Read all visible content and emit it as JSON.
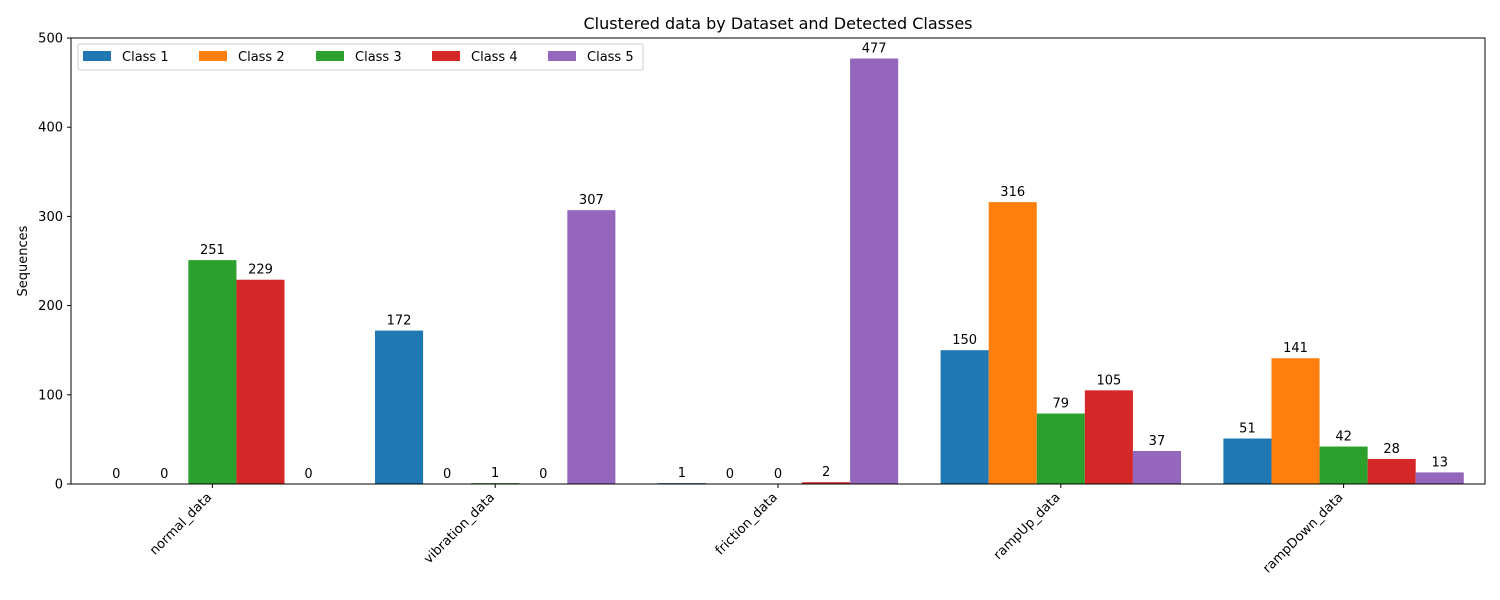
{
  "chart_data": {
    "type": "bar",
    "title": "Clustered data by Dataset and Detected Classes",
    "xlabel": "",
    "ylabel": "Sequences",
    "categories": [
      "normal_data",
      "vibration_data",
      "friction_data",
      "rampUp_data",
      "rampDown_data"
    ],
    "series": [
      {
        "name": "Class 1",
        "color": "#1f77b4",
        "values": [
          0,
          172,
          1,
          150,
          51
        ]
      },
      {
        "name": "Class 2",
        "color": "#ff7f0e",
        "values": [
          0,
          0,
          0,
          316,
          141
        ]
      },
      {
        "name": "Class 3",
        "color": "#2ca02c",
        "values": [
          251,
          1,
          0,
          79,
          42
        ]
      },
      {
        "name": "Class 4",
        "color": "#d62728",
        "values": [
          229,
          0,
          2,
          105,
          28
        ]
      },
      {
        "name": "Class 5",
        "color": "#9467bd",
        "values": [
          0,
          307,
          477,
          37,
          13
        ]
      }
    ],
    "ylim": [
      0,
      500
    ],
    "yticks": [
      0,
      100,
      200,
      300,
      400,
      500
    ],
    "legend": "top-left",
    "grid": false,
    "data_labels": true
  }
}
